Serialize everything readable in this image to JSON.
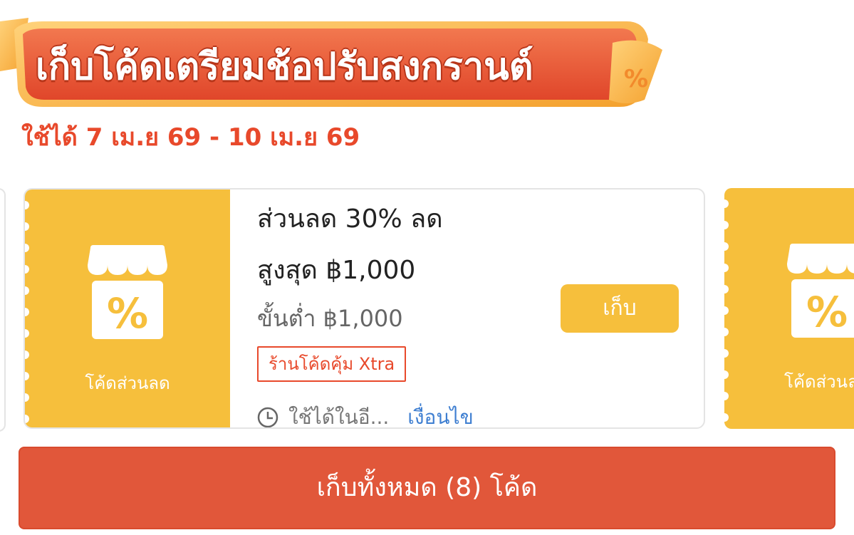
{
  "banner": {
    "title": "เก็บโค้ดเตรียมช้อปรับสงกรานต์",
    "date_range": "ใช้ได้ 7 เม.ย 69 - 10 เม.ย 69"
  },
  "voucher": {
    "stub_label": "โค้ดส่วนลด",
    "title_line1": "ส่วนลด 30% ลด",
    "title_line2": "สูงสุด ฿1,000",
    "min_spend": "ขั้นต่ำ ฿1,000",
    "tag": "ร้านโค้ดคุ้ม Xtra",
    "validity": "ใช้ได้ในอี...",
    "conditions_link": "เงื่อนไข",
    "collect_label": "เก็บ"
  },
  "next_voucher": {
    "stub_label": "โค้ดส่วนล"
  },
  "collect_all_label": "เก็บทั้งหมด (8) โค้ด",
  "colors": {
    "accent": "#e8492b",
    "voucher_yellow": "#f6bf3c",
    "link_blue": "#3f7fd1",
    "collect_all_bg": "#e1573a"
  },
  "icons": [
    "shop-discount-icon",
    "clock-icon",
    "percent-ribbon-icon"
  ]
}
